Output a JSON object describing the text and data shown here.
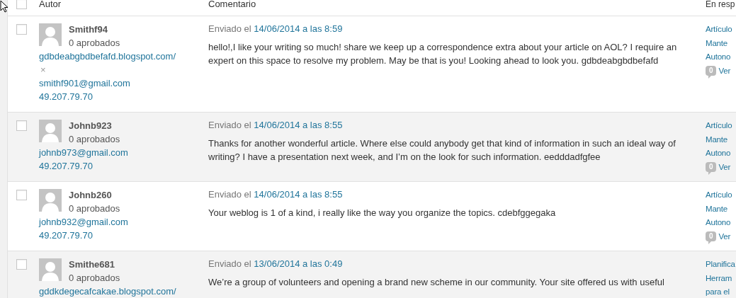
{
  "table": {
    "all_selected": false,
    "columns": [
      "Autor",
      "Comentario",
      "En resp"
    ],
    "rows": [
      {
        "selected": false,
        "shaded": false,
        "author": {
          "name": "Smithf94",
          "approved": "0 aprobados",
          "lines": [
            {
              "kind": "link",
              "text": "gdbdeabgbdbefafd.blogspot.com/"
            },
            {
              "kind": "mark",
              "text": "×"
            },
            {
              "kind": "link",
              "text": "smithf901@gmail.com"
            },
            {
              "kind": "link",
              "text": "49.207.79.70"
            }
          ]
        },
        "sent_label": "Enviado el",
        "date": "14/06/2014 a las 8:59",
        "comment": "hello!,I like your writing so much! share we keep up a correspondence extra about your article on AOL? I require an expert on this space to resolve my problem. May be that is you! Looking ahead to look you. gdbdeabgbdbefafd",
        "response": {
          "lines": [
            "Artículo",
            "Mante",
            "Autono"
          ],
          "count": "0",
          "view": "Ver"
        }
      },
      {
        "selected": false,
        "shaded": true,
        "author": {
          "name": "Johnb923",
          "approved": "0 aprobados",
          "lines": [
            {
              "kind": "link",
              "text": "johnb973@gmail.com"
            },
            {
              "kind": "link",
              "text": "49.207.79.70"
            }
          ]
        },
        "sent_label": "Enviado el",
        "date": "14/06/2014 a las 8:55",
        "comment": "Thanks for another wonderful article. Where else could anybody get that kind of information in such an ideal way of writing? I have a presentation next week, and I’m on the look for such information. eedddadfgfee",
        "response": {
          "lines": [
            "Artículo",
            "Mante",
            "Autono"
          ],
          "count": "0",
          "view": "Ver"
        }
      },
      {
        "selected": false,
        "shaded": false,
        "author": {
          "name": "Johnb260",
          "approved": "0 aprobados",
          "lines": [
            {
              "kind": "link",
              "text": "johnb932@gmail.com"
            },
            {
              "kind": "link",
              "text": "49.207.79.70"
            }
          ]
        },
        "sent_label": "Enviado el",
        "date": "14/06/2014 a las 8:55",
        "comment": "Your weblog is 1 of a kind, i really like the way you organize the topics. cdebfggegaka",
        "response": {
          "lines": [
            "Artículo",
            "Mante",
            "Autono"
          ],
          "count": "0",
          "view": "Ver"
        }
      },
      {
        "selected": false,
        "shaded": true,
        "author": {
          "name": "Smithe681",
          "approved": "0 aprobados",
          "lines": [
            {
              "kind": "link",
              "text": "gddkdegecafcakae.blogspot.com/"
            }
          ]
        },
        "sent_label": "Enviado el",
        "date": "13/06/2014 a las 0:49",
        "comment": "We’re a group of volunteers and opening a brand new scheme in our community. Your site offered us with useful",
        "response": {
          "lines": [
            "Planifica",
            "Herram",
            "para el"
          ]
        }
      }
    ]
  }
}
